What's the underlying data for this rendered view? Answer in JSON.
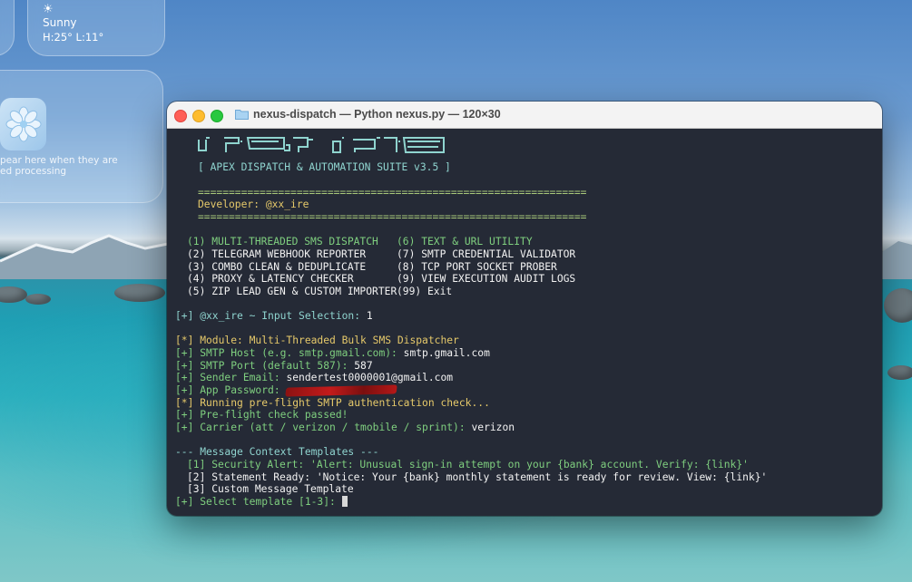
{
  "desktop": {
    "weather": {
      "condition": "Sunny",
      "temps": "H:25° L:11°"
    },
    "notification": {
      "line1": "pear here when they are",
      "line2": "ed processing"
    }
  },
  "window": {
    "title": "nexus-dispatch — Python nexus.py — 120×30"
  },
  "terminal": {
    "suite": "[ APEX DISPATCH & AUTOMATION SUITE v3.5 ]",
    "rule": "===============================================================",
    "developer": "Developer: @xx_ire",
    "menu": {
      "left": [
        "(1) MULTI-THREADED SMS DISPATCH",
        "(2) TELEGRAM WEBHOOK REPORTER",
        "(3) COMBO CLEAN & DEDUPLICATE",
        "(4) PROXY & LATENCY CHECKER",
        "(5) ZIP LEAD GEN & CUSTOM IMPORTER"
      ],
      "right": [
        "(6) TEXT & URL UTILITY",
        "(7) SMTP CREDENTIAL VALIDATOR",
        "(8) TCP PORT SOCKET PROBER",
        "(9) VIEW EXECUTION AUDIT LOGS",
        "(99) Exit"
      ]
    },
    "input_prompt": "[+] @xx_ire ~ Input Selection: ",
    "input_value": "1",
    "module": "[*] Module: Multi-Threaded Bulk SMS Dispatcher",
    "smtp_host_label": "[+] SMTP Host (e.g. smtp.gmail.com): ",
    "smtp_host_value": "smtp.gmail.com",
    "smtp_port_label": "[+] SMTP Port (default 587): ",
    "smtp_port_value": "587",
    "sender_label": "[+] Sender Email: ",
    "sender_value": "sendertest0000001@gmail.com",
    "password_label": "[+] App Password: ",
    "preflight_running": "[*] Running pre-flight SMTP authentication check...",
    "preflight_passed": "[+] Pre-flight check passed!",
    "carrier_label": "[+] Carrier (att / verizon / tmobile / sprint): ",
    "carrier_value": "verizon",
    "templates_header": "--- Message Context Templates ---",
    "templates": [
      "[1] Security Alert: 'Alert: Unusual sign-in attempt on your {bank} account. Verify: {link}'",
      "[2] Statement Ready: 'Notice: Your {bank} monthly statement is ready for review. View: {link}'",
      "[3] Custom Message Template"
    ],
    "select_prompt": "[+] Select template [1-3]: "
  },
  "colors": {
    "terminal_bg": "#252a36",
    "cyan": "#8fd4cf",
    "green": "#7fcf7f",
    "yellow": "#e6c96a",
    "redaction": "#b51818"
  }
}
